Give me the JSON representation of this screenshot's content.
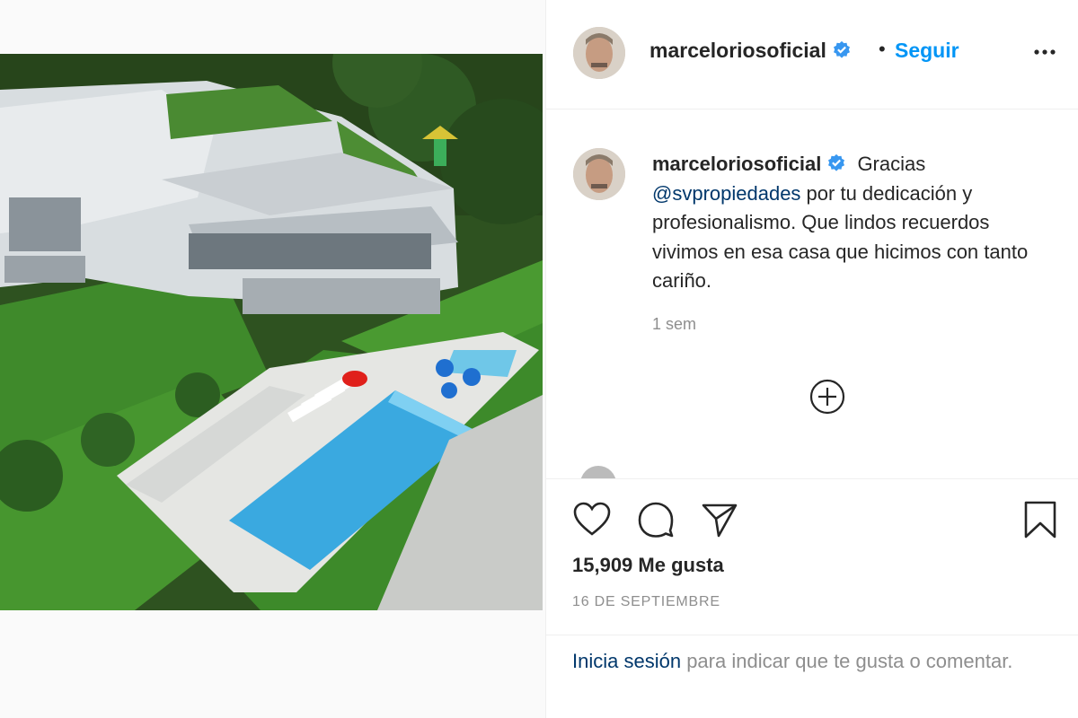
{
  "post": {
    "username": "marceloriosoficial",
    "verified": true,
    "follow_label": "Seguir",
    "separator": "•"
  },
  "caption": {
    "username": "marceloriosoficial",
    "before_mention": "Gracias ",
    "mention": "@svpropiedades",
    "after_mention": " por tu dedicación y profesionalismo. Que lindos recuerdos vivimos en esa casa que hicimos con tanto cariño.",
    "time": "1 sem"
  },
  "actions": {
    "likes_text": "15,909 Me gusta",
    "date": "16 DE SEPTIEMBRE"
  },
  "login": {
    "link": "Inicia sesión",
    "rest": " para indicar que te gusta o comentar."
  },
  "icons": {
    "verified": "verified-badge-icon",
    "more": "more-options-icon",
    "load_more": "load-more-comments-icon",
    "like": "heart-icon",
    "comment": "comment-bubble-icon",
    "share": "paper-plane-icon",
    "save": "bookmark-icon"
  },
  "colors": {
    "accent": "#0095f6",
    "mention": "#00376b",
    "muted": "#8e8e8e"
  }
}
